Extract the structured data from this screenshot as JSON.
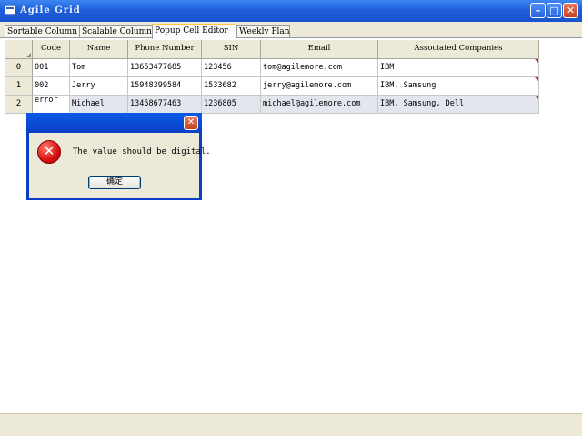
{
  "window": {
    "title": "Agile Grid"
  },
  "tabs": [
    {
      "label": "Sortable Column"
    },
    {
      "label": "Scalable Column"
    },
    {
      "label": "Popup Cell Editor",
      "active": true
    },
    {
      "label": "Weekly Plan"
    }
  ],
  "grid": {
    "columns": [
      "Code",
      "Name",
      "Phone Number",
      "SIN",
      "Email",
      "Associated Companies"
    ],
    "rows": [
      {
        "header": "0",
        "cells": [
          "001",
          "Tom",
          "13653477685",
          "123456",
          "tom@agilemore.com",
          "IBM"
        ]
      },
      {
        "header": "1",
        "cells": [
          "002",
          "Jerry",
          "15948399584",
          "1533682",
          "jerry@agilemore.com",
          "IBM, Samsung"
        ]
      },
      {
        "header": "2",
        "cells": [
          "error",
          "Michael",
          "13458677463",
          "1236805",
          "michael@agilemore.com",
          "IBM, Samsung, Dell"
        ]
      }
    ]
  },
  "dialog": {
    "message": "The value should be digital.",
    "ok_label": "确定",
    "icon": "error-icon"
  },
  "colors": {
    "titlebar": "#1f5fdc",
    "dialog_border": "#0a3ec8",
    "error_red": "#d81010",
    "chrome": "#ece9d8"
  }
}
